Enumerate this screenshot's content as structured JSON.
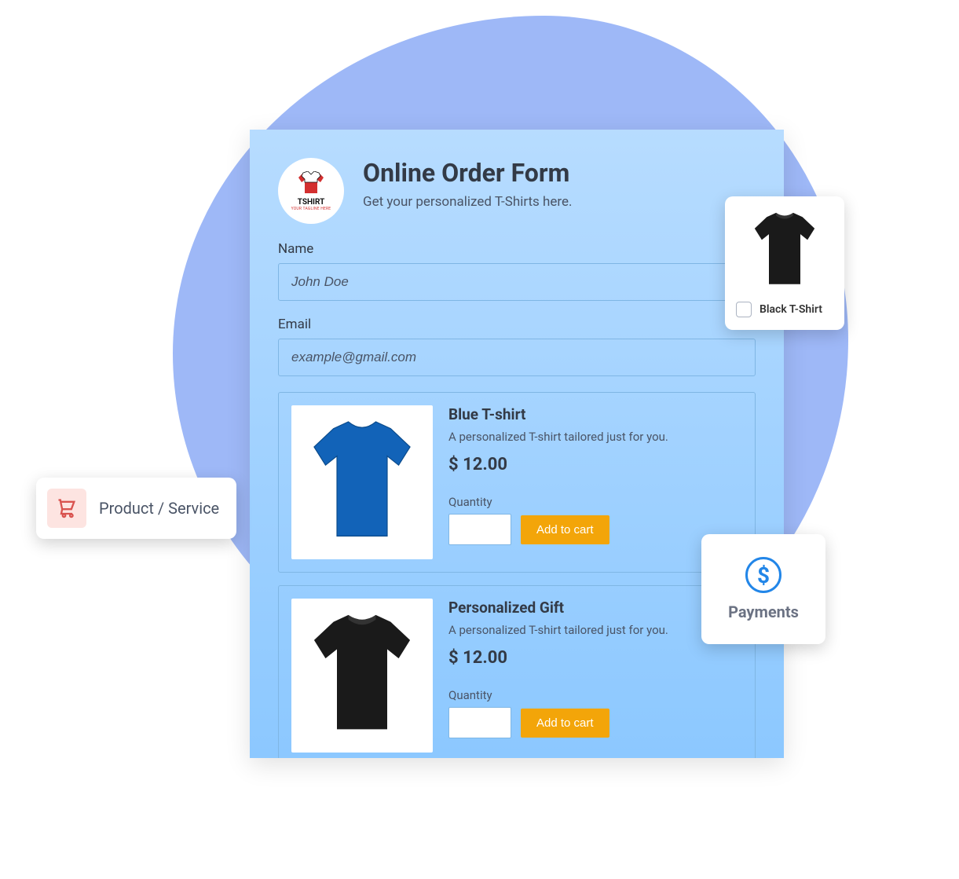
{
  "logo": {
    "brand": "TSHIRT",
    "tagline": "YOUR TAGLINE HERE"
  },
  "header": {
    "title": "Online Order Form",
    "subtitle": "Get your personalized T-Shirts here."
  },
  "fields": {
    "name": {
      "label": "Name",
      "value": "John Doe"
    },
    "email": {
      "label": "Email",
      "value": "example@gmail.com"
    }
  },
  "products": [
    {
      "title": "Blue T-shirt",
      "description": "A personalized T-shirt tailored just for you.",
      "price": "$ 12.00",
      "quantity_label": "Quantity",
      "button": "Add to cart",
      "color": "#1263b8"
    },
    {
      "title": "Personalized Gift",
      "description": "A personalized T-shirt tailored just for you.",
      "price": "$ 12.00",
      "quantity_label": "Quantity",
      "button": "Add to cart",
      "color": "#1a1a1a"
    }
  ],
  "thumb": {
    "label": "Black T-Shirt",
    "color": "#1a1a1a"
  },
  "tag": {
    "label": "Product / Service"
  },
  "payments": {
    "label": "Payments"
  }
}
